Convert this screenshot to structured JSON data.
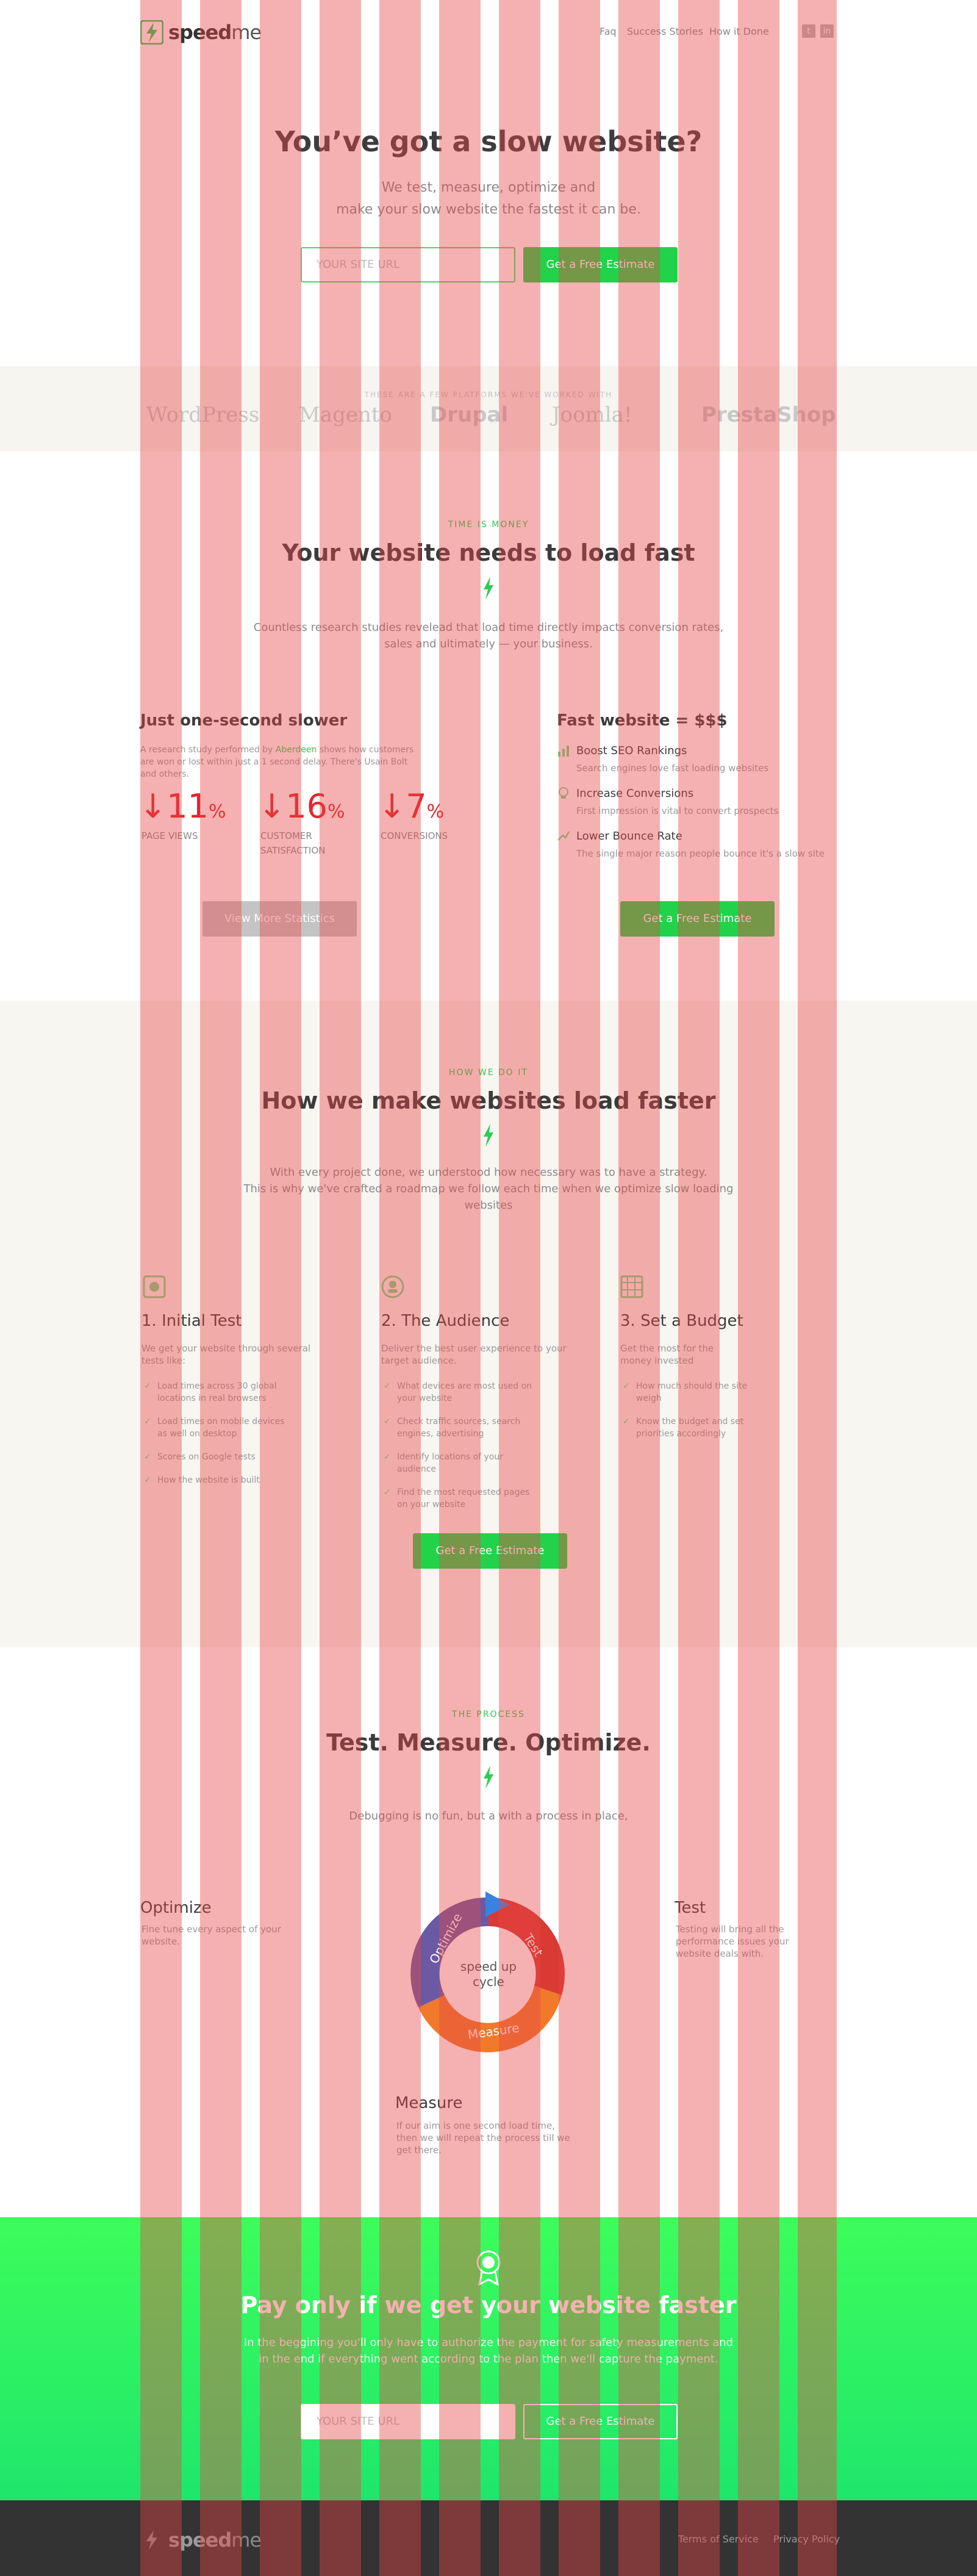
{
  "header": {
    "logo_text_bold": "speed",
    "logo_text_rest": "me",
    "nav": [
      "Faq",
      "Success Stories",
      "How it Done"
    ],
    "social": [
      "t",
      "in"
    ]
  },
  "hero": {
    "title": "You’ve got a slow website?",
    "subtitle_line1": "We test, measure, optimize and",
    "subtitle_line2": "make your slow website the fastest it can be.",
    "url_placeholder": "YOUR SITE URL",
    "cta": "Get a Free Estimate"
  },
  "partners": {
    "label": "THESE ARE A FEW PLATFORMS WE'VE WORKED WITH",
    "items": [
      "WordPress",
      "Magento",
      "Drupal",
      "Joomla!",
      "PrestaShop"
    ]
  },
  "money": {
    "kicker": "TIME IS MONEY",
    "title": "Your website needs to load fast",
    "text_line1": "Countless research studies revelead that load time directly impacts conversion rates,",
    "text_line2": "sales and ultimately — your business.",
    "slow": {
      "title": "Just one-second slower",
      "text_pre": "A research study performed by ",
      "text_link": "Aberdeen",
      "text_post": " shows how customers are won or lost within just a 1 second delay. There's Usain Bolt and others.",
      "stats": [
        {
          "value": "11",
          "unit": "%",
          "label": "PAGE VIEWS"
        },
        {
          "value": "16",
          "unit": "%",
          "label": "CUSTOMER SATISFACTION"
        },
        {
          "value": "7",
          "unit": "%",
          "label": "CONVERSIONS"
        }
      ],
      "button": "View More Statistics"
    },
    "fast": {
      "title": "Fast website = $$$",
      "features": [
        {
          "title": "Boost SEO Rankings",
          "text": "Search engines love fast loading websites"
        },
        {
          "title": "Increase Conversions",
          "text": "First impression is vital to convert prospects"
        },
        {
          "title": "Lower Bounce Rate",
          "text": "The single major reason people bounce it's a slow site"
        }
      ],
      "button": "Get a Free Estimate"
    }
  },
  "how": {
    "kicker": "HOW WE DO IT",
    "title": "How we make websites load faster",
    "text_line1": "With every project done, we understood how necessary was to have a strategy.",
    "text_line2": "This is why we've crafted a roadmap we follow each time when we optimize slow loading",
    "text_line3": "websites",
    "steps": [
      {
        "title": "1. Initial Test",
        "intro": "We get your website through several tests like:",
        "items": [
          "Load times across 30 global locations in real browsers",
          "Load times on mobile devices as well on desktop",
          "Scores on Google tests",
          "How the website is built"
        ]
      },
      {
        "title": "2. The Audience",
        "intro": "Deliver the best user experience to your target audience.",
        "items": [
          "What devices are most used on your website",
          "Check traffic sources, search engines, advertising",
          "Identify locations of your audience",
          "Find the most requested pages on your website"
        ]
      },
      {
        "title": "3. Set a Budget",
        "intro": "Get the most for the money invested",
        "items": [
          "How much should the site weigh",
          "Know the budget and set priorities accordingly"
        ]
      }
    ],
    "button": "Get a Free Estimate"
  },
  "process": {
    "kicker": "THE PROCESS",
    "title": "Test. Measure. Optimize.",
    "text": "Debugging is no fun, but a with a process in place,",
    "cycle_center_1": "speed up",
    "cycle_center_2": "cycle",
    "arc_labels": [
      "Optimize",
      "Test",
      "Measure"
    ],
    "optimize": {
      "title": "Optimize",
      "text": "Fine tune every aspect of your website."
    },
    "test": {
      "title": "Test",
      "text": "Testing will bring all the performance issues your website deals with."
    },
    "measure": {
      "title": "Measure",
      "text": "If our aim is one second load time, then we will repeat the process till we get there."
    }
  },
  "band": {
    "title": "Pay only if we get your website faster",
    "text_line1": "In the beggining you'll only have to authorize the payment for safety measurements and",
    "text_line2": "in the end if everything went according to the plan then we'll capture the payment.",
    "url_placeholder": "YOUR SITE URL",
    "cta": "Get a Free Estimate"
  },
  "footer": {
    "logo_text_bold": "speed",
    "logo_text_rest": "me",
    "links": [
      "Terms of Service",
      "Privacy Policy"
    ]
  },
  "colors": {
    "accent": "#22d24a",
    "stat_red": "#e3262e",
    "overlay": "#e64646",
    "footer_bg": "#333333"
  }
}
